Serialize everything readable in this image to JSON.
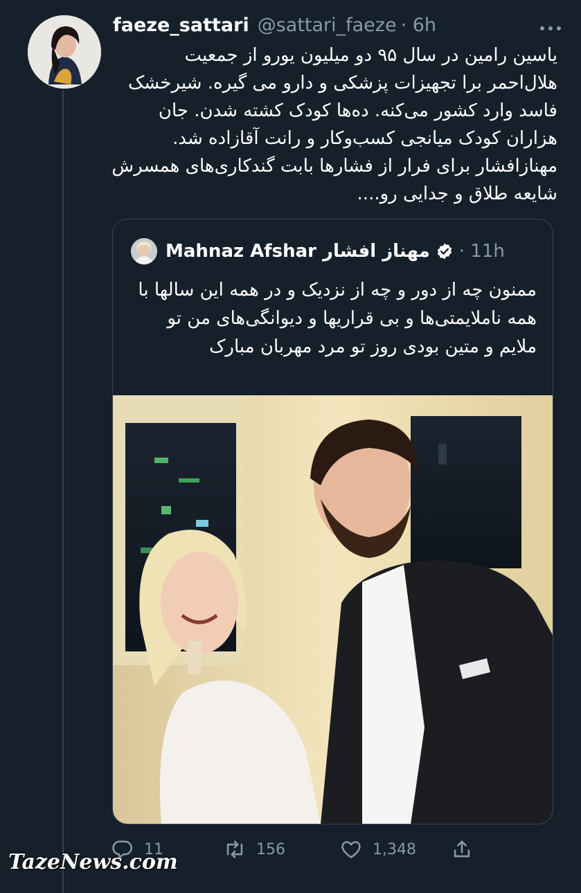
{
  "tweet": {
    "author_name": "faeze_sattari",
    "author_handle": "@sattari_faeze",
    "time": "· 6h",
    "text": "یاسین رامین در سال ۹۵ دو میلیون یورو از جمعیت هلال‌احمر برا تجهیزات پزشکی و دارو می گیره. شیرخشک فاسد وارد کشور می‌کنه. ده‌ها کودک کشته شدن. جان هزاران کودک میانجی کسب‌وکار و رانت آقازاده شد. مهنازافشار برای فرار از فشارها بابت گندکاری‌های همسرش شایعه طلاق و جدایی رو....",
    "more_icon": "more-icon"
  },
  "quote": {
    "author_name": "Mahnaz Afshar مهناز افشار",
    "time": "· 11h",
    "verified_icon": "verified-badge-icon",
    "text": "ممنون چه از دور و چه از نزدیک و در همه این سالها با همه ناملایمتی‌ها و بی قراریها و دیوانگی‌های من تو ملایم و متین بودی روز تو مرد مهربان مبارک"
  },
  "actions": {
    "reply_count": "11",
    "retweet_count": "156",
    "like_count": "1,348",
    "icons": [
      "reply-icon",
      "retweet-icon",
      "like-icon",
      "share-icon"
    ]
  },
  "watermark": "TazeNews.com",
  "colors": {
    "background": "#15202b",
    "border": "#38444d",
    "secondary_text": "#8899a6",
    "verified": "#ffffff"
  }
}
